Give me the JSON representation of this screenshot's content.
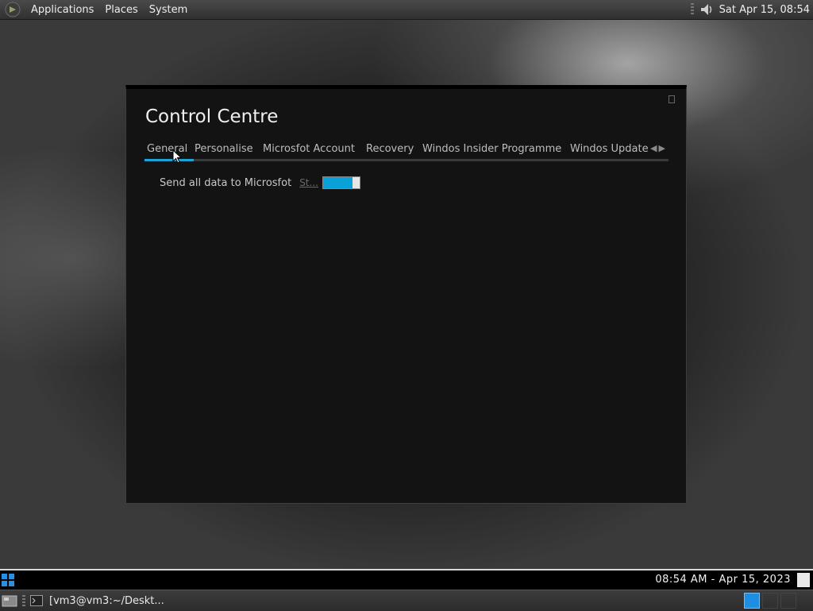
{
  "top_panel": {
    "menus": [
      "Applications",
      "Places",
      "System"
    ],
    "clock": "Sat Apr 15, 08:54",
    "icons": [
      "gnome-foot-icon",
      "volume-icon"
    ]
  },
  "window": {
    "title": "Control Centre",
    "tabs": [
      "General",
      "Personalise",
      "Microsfot Account",
      "Recovery",
      "Windos Insider Programme",
      "Windos Update"
    ],
    "active_tab": "General",
    "setting": {
      "label": "Send all data to Microsfot",
      "state_text": "St...",
      "toggle_on": true
    },
    "accent_color": "#1fa3d6"
  },
  "taskbar": {
    "clock": "08:54 AM - Apr 15, 2023"
  },
  "bottom_panel": {
    "task_label": "[vm3@vm3:~/Deskt..."
  }
}
